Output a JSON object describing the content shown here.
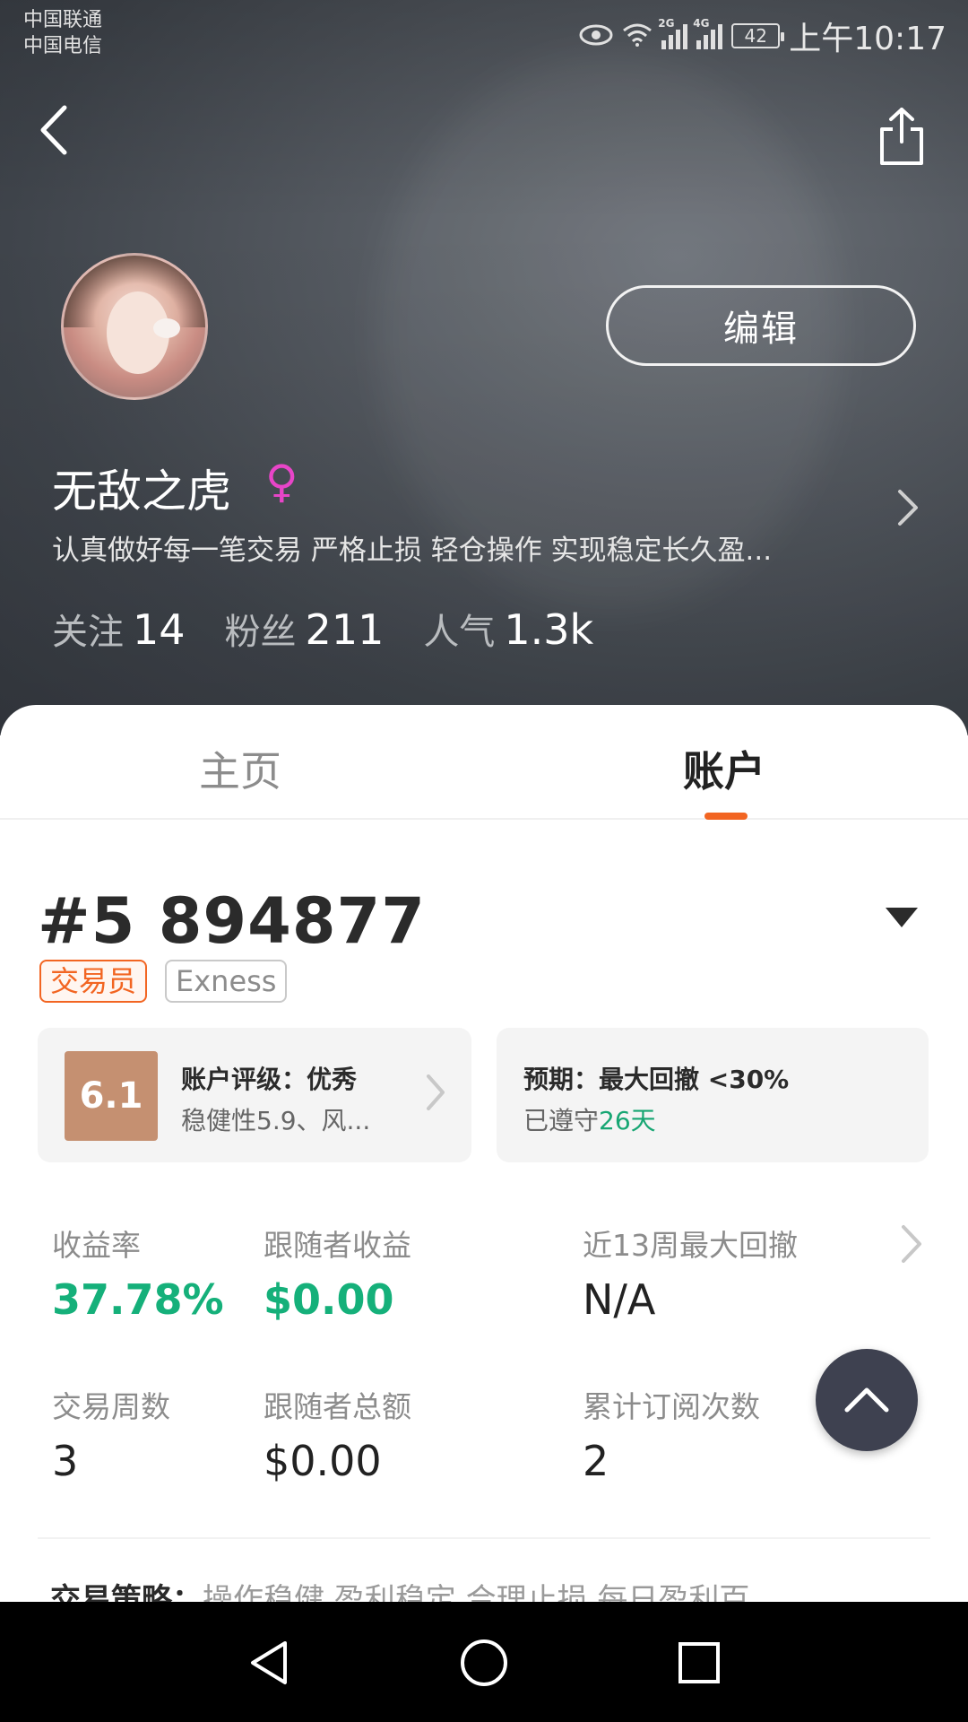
{
  "status_bar": {
    "carrier_1": "中国联通",
    "carrier_2": "中国电信",
    "signal_1_tag": "2G",
    "signal_2_tag": "4G",
    "battery": "42",
    "time": "上午10:17"
  },
  "profile": {
    "name": "无敌之虎",
    "gender_symbol": "♀",
    "bio": "认真做好每一笔交易 严格止损 轻仓操作 实现稳定长久盈...",
    "edit_label": "编辑",
    "stats": [
      {
        "label": "关注",
        "value": "14"
      },
      {
        "label": "粉丝",
        "value": "211"
      },
      {
        "label": "人气",
        "value": "1.3k"
      }
    ]
  },
  "tabs": [
    {
      "label": "主页"
    },
    {
      "label": "账户"
    }
  ],
  "account": {
    "number": "#5 894877",
    "role_tag": "交易员",
    "broker_tag": "Exness",
    "rating": {
      "score": "6.1",
      "title": "账户评级：优秀",
      "subtitle": "稳健性5.9、风..."
    },
    "expectation": {
      "title": "预期：最大回撤 <30%",
      "kept_prefix": "已遵守",
      "kept_days": "26天"
    },
    "metrics": [
      {
        "label": "收益率",
        "value": "37.78%"
      },
      {
        "label": "跟随者收益",
        "value": "$0.00"
      },
      {
        "label": "近13周最大回撤",
        "value": "N/A"
      },
      {
        "label": "交易周数",
        "value": "3"
      },
      {
        "label": "跟随者总额",
        "value": "$0.00"
      },
      {
        "label": "累计订阅次数",
        "value": "2"
      }
    ],
    "strategy_label": "交易策略：",
    "strategy_text": "操作稳健 盈利稳定 合理止损 每日盈利百"
  },
  "colors": {
    "accent": "#f26522",
    "positive": "#15b07a",
    "score_badge": "#c59071",
    "gender": "#e845c8"
  }
}
